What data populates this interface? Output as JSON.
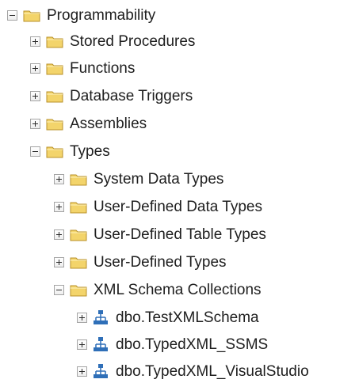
{
  "tree": {
    "root": {
      "label": "Programmability",
      "expanded": true,
      "icon": "folder-icon"
    },
    "stored_procedures": {
      "label": "Stored Procedures",
      "expanded": false,
      "icon": "folder-icon"
    },
    "functions": {
      "label": "Functions",
      "expanded": false,
      "icon": "folder-icon"
    },
    "database_triggers": {
      "label": "Database Triggers",
      "expanded": false,
      "icon": "folder-icon"
    },
    "assemblies": {
      "label": "Assemblies",
      "expanded": false,
      "icon": "folder-icon"
    },
    "types": {
      "label": "Types",
      "expanded": true,
      "icon": "folder-icon"
    },
    "system_data_types": {
      "label": "System Data Types",
      "expanded": false,
      "icon": "folder-icon"
    },
    "user_defined_data_types": {
      "label": "User-Defined Data Types",
      "expanded": false,
      "icon": "folder-icon"
    },
    "user_defined_table_types": {
      "label": "User-Defined Table Types",
      "expanded": false,
      "icon": "folder-icon"
    },
    "user_defined_types": {
      "label": "User-Defined Types",
      "expanded": false,
      "icon": "folder-icon"
    },
    "xml_schema_collections": {
      "label": "XML Schema Collections",
      "expanded": true,
      "icon": "folder-icon"
    },
    "schemas": [
      {
        "label": "dbo.TestXMLSchema",
        "expanded": false,
        "icon": "xml-schema-icon"
      },
      {
        "label": "dbo.TypedXML_SSMS",
        "expanded": false,
        "icon": "xml-schema-icon"
      },
      {
        "label": "dbo.TypedXML_VisualStudio",
        "expanded": false,
        "icon": "xml-schema-icon"
      }
    ]
  },
  "colors": {
    "folder_fill": "#f3d46b",
    "folder_edge": "#b8912a",
    "schema_icon": "#2f6fb8",
    "text": "#1e1e1e"
  }
}
